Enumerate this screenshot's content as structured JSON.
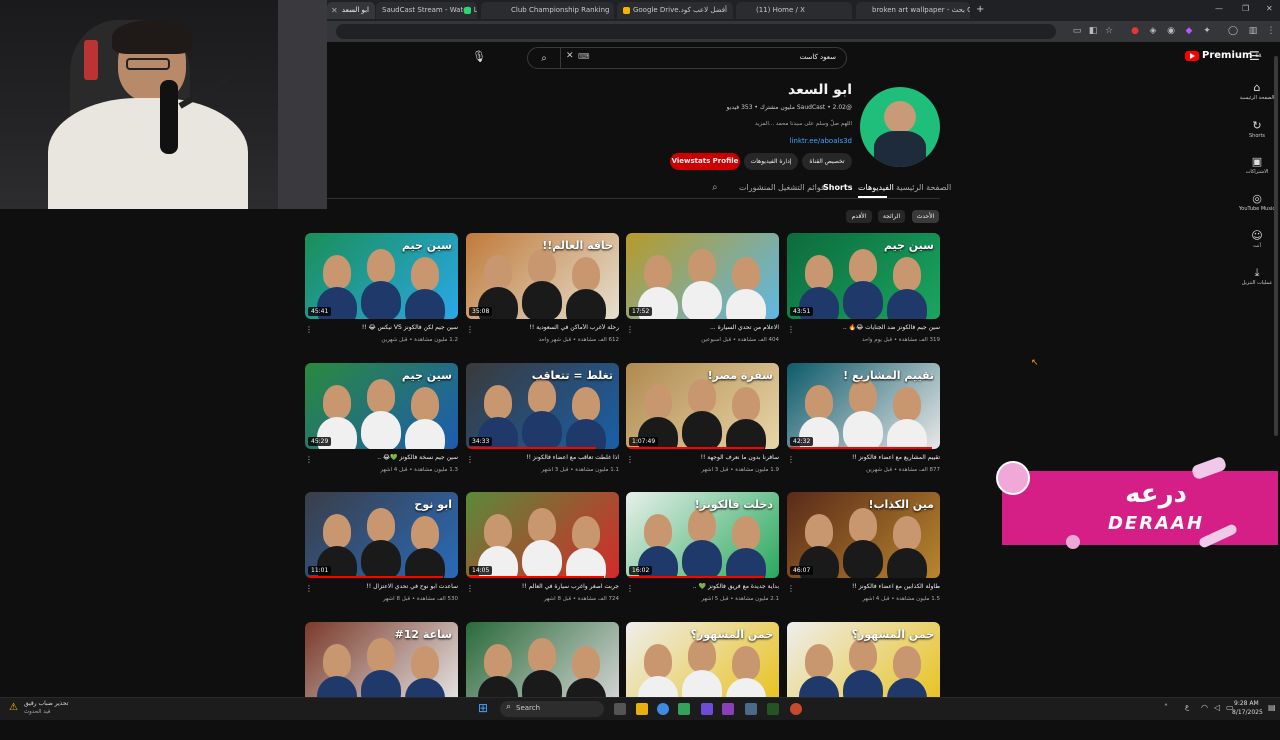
{
  "browser": {
    "tabs": [
      {
        "title": "ابو السعد",
        "active": true
      },
      {
        "title": "SaudCast Stream - Watch Live"
      },
      {
        "title": "Club Championship Ranking"
      },
      {
        "title": "أفضل لاعب كود.Google Drive"
      },
      {
        "title": "(11) Home / X"
      },
      {
        "title": "broken art wallpaper - بحث Go"
      }
    ],
    "new_tab": "+"
  },
  "header": {
    "search_value": "سعود كاست",
    "premium_label": "Premium",
    "premium_region": "SA"
  },
  "nav": [
    {
      "label": "الصفحة الرئيسية",
      "icon": "home-icon"
    },
    {
      "label": "Shorts",
      "icon": "shorts-icon"
    },
    {
      "label": "الاشتراكات",
      "icon": "subscriptions-icon"
    },
    {
      "label": "YouTube Music",
      "icon": "music-icon"
    },
    {
      "label": "أنت",
      "icon": "you-icon"
    },
    {
      "label": "عمليات التنزيل",
      "icon": "download-icon"
    }
  ],
  "channel": {
    "name": "ابو السعد",
    "stats": "@SaudCast • 2.02 مليون مشترك • 353 فيديو",
    "description": "اللهم صلّ وسلم على سيدنا محمد ...المزيد",
    "link": "linktr.ee/aboals3d",
    "buttons": {
      "customize": "تخصيص القناة",
      "manage": "إدارة الفيديوهات",
      "viewstats": "Viewstats Profile"
    },
    "tabs": [
      "الصفحة الرئيسية",
      "الفيديوهات",
      "Shorts",
      "قوائم التشغيل",
      "المنشورات"
    ],
    "active_tab": "الفيديوهات",
    "chips": [
      "الأحدث",
      "الرائجة",
      "الأقدم"
    ]
  },
  "videos": [
    {
      "title": "سين جيم فالكونز ضد الجنايات 😂🔥 ..",
      "meta": "319 ألف مشاهدة • قبل يوم واحد",
      "duration": "43:51",
      "overlay": "سين جيم",
      "progress": 0.0
    },
    {
      "title": "الاعلام من تحدي السيارة ...",
      "meta": "404 ألف مشاهدة • قبل أسبوعين",
      "duration": "17:52",
      "overlay": "",
      "progress": 0.0
    },
    {
      "title": "رحلة لأغرب الأماكن في السعودية !!",
      "meta": "612 ألف مشاهدة • قبل شهر واحد",
      "duration": "35:08",
      "overlay": "حافة العالم!!",
      "progress": 0.0
    },
    {
      "title": "سين جيم لكن فالكونز VS نيكس 😂 !!",
      "meta": "1.2 مليون مشاهدة • قبل شهرين",
      "duration": "45:41",
      "overlay": "سين جيم",
      "progress": 0.0
    },
    {
      "title": "تقييم المشاريع مع اعضاء فالكونز !!",
      "meta": "877 ألف مشاهدة • قبل شهرين",
      "duration": "42:32",
      "overlay": "تقييم المشاريع !",
      "progress": 0.95
    },
    {
      "title": "سافرنا بدون ما نعرف الوجهة !!",
      "meta": "1.9 مليون مشاهدة • قبل 3 أشهر",
      "duration": "1:07:49",
      "overlay": "سفرة مصر!",
      "progress": 0.9
    },
    {
      "title": "اذا غلطت تعاقب مع اعضاء فالكونز !!",
      "meta": "1.1 مليون مشاهدة • قبل 3 أشهر",
      "duration": "34:33",
      "overlay": "تغلط = تتعاقب",
      "progress": 0.85
    },
    {
      "title": "سين جيم نسخة فالكونز 💚😂 ..",
      "meta": "1.3 مليون مشاهدة • قبل 4 أشهر",
      "duration": "45:29",
      "overlay": "سين جيم",
      "progress": 0.0
    },
    {
      "title": "طاولة الكذابين مع اعضاء فالكونز !!",
      "meta": "1.5 مليون مشاهدة • قبل 4 أشهر",
      "duration": "46:07",
      "overlay": "مين الكذاب!",
      "progress": 0.0
    },
    {
      "title": "بداية جديدة مع فريق فالكونز 💚 ..",
      "meta": "2.1 مليون مشاهدة • قبل 5 أشهر",
      "duration": "16:02",
      "overlay": "دخلت فالكونز!",
      "progress": 0.9
    },
    {
      "title": "جربت اصغر واغرب سيارة في العالم !!",
      "meta": "724 ألف مشاهدة • قبل 8 أشهر",
      "duration": "14:05",
      "overlay": "",
      "progress": 0.9
    },
    {
      "title": "ساعدت ابو نوح في تحدي الاعتزال !!",
      "meta": "530 ألف مشاهدة • قبل 8 أشهر",
      "duration": "11:01",
      "overlay": "ابو نوح",
      "progress": 0.9
    },
    {
      "title": "",
      "meta": "",
      "duration": "",
      "overlay": "خمن المشهور؟",
      "progress": 0.0
    },
    {
      "title": "",
      "meta": "",
      "duration": "",
      "overlay": "خمن المشهور؟",
      "progress": 0.0
    },
    {
      "title": "",
      "meta": "",
      "duration": "",
      "overlay": "",
      "progress": 0.0
    },
    {
      "title": "",
      "meta": "",
      "duration": "",
      "overlay": "ساعة 12#",
      "progress": 0.0
    }
  ],
  "derah": {
    "arabic": "درعه",
    "latin": "DERAAH"
  },
  "taskbar": {
    "weather_title": "تحذير ضباب رقيق",
    "weather_sub": "قيد الحدوث",
    "search_label": "Search",
    "time": "9:28 AM",
    "date": "8/17/2025"
  },
  "colors": {
    "accent": "#ff0000",
    "bg": "#0f0f0f",
    "derah": "#d61f86",
    "avatar": "#1fbf7b"
  }
}
